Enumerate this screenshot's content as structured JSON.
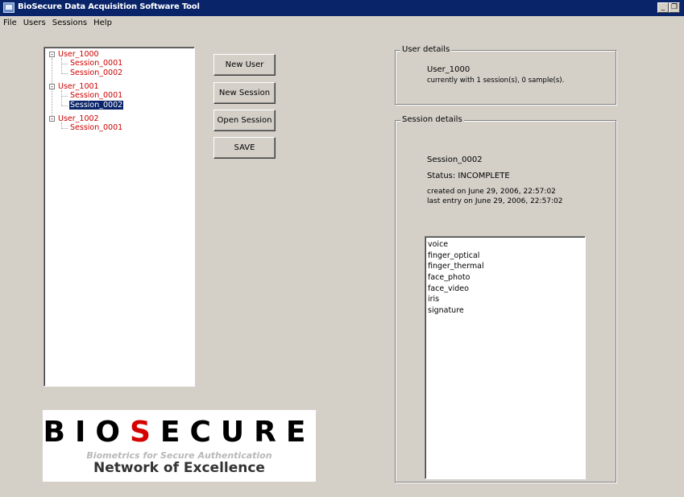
{
  "window": {
    "title": "BioSecure Data Acquisition Software Tool"
  },
  "menu": [
    "File",
    "Users",
    "Sessions",
    "Help"
  ],
  "tree": {
    "users": [
      {
        "label": "User_1000",
        "sessions": [
          "Session_0001",
          "Session_0002"
        ]
      },
      {
        "label": "User_1001",
        "sessions": [
          "Session_0001",
          "Session_0002"
        ]
      },
      {
        "label": "User_1002",
        "sessions": [
          "Session_0001"
        ]
      }
    ],
    "selected": "User_1001/Session_0002"
  },
  "buttons": {
    "new_user": "New User",
    "new_session": "New Session",
    "open_session": "Open Session",
    "save": "SAVE"
  },
  "user_details": {
    "legend": "User details",
    "name": "User_1000",
    "summary": "currently with 1 session(s), 0 sample(s)."
  },
  "session_details": {
    "legend": "Session details",
    "name": "Session_0002",
    "status": "Status: INCOMPLETE",
    "created": "created on June 29, 2006, 22:57:02",
    "last_entry": "last entry on June 29, 2006, 22:57:02",
    "modalities": [
      "voice",
      "finger_optical",
      "finger_thermal",
      "face_photo",
      "face_video",
      "iris",
      "signature"
    ]
  },
  "logo": {
    "word_part1": "BIO",
    "word_part2": "S",
    "word_part3": "ECURE",
    "tagline": "Biometrics for Secure Authentication",
    "network": "Network of Excellence"
  },
  "colors": {
    "title_bar": "#0a246a",
    "tree_text": "#cc0000",
    "logo_accent": "#d40000"
  }
}
